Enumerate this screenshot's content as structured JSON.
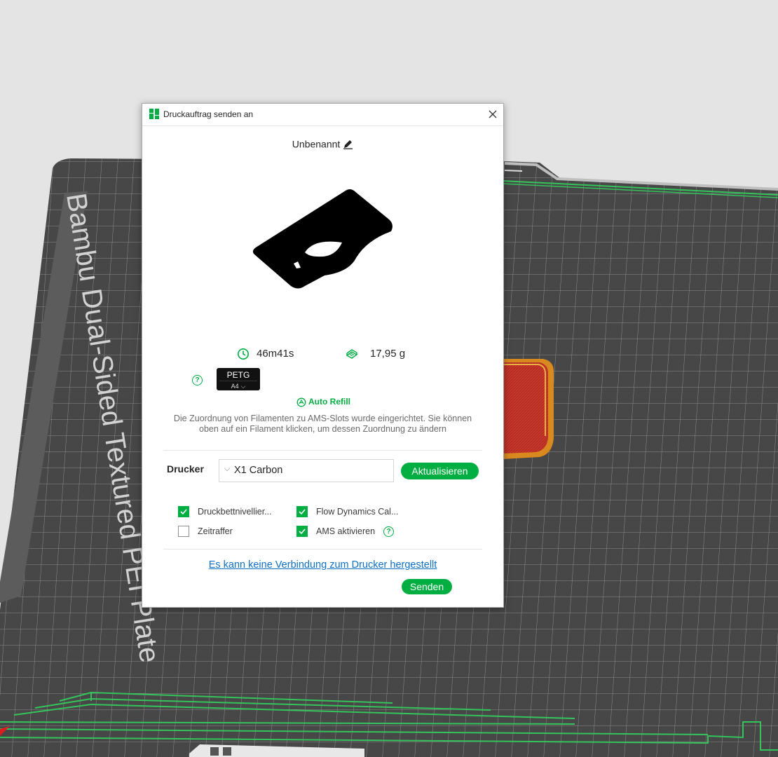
{
  "background": {
    "bed_label": "Bambu Dual-Sided Textured PEI Plate",
    "colors": {
      "bed": "#474747",
      "grid": "#8c8c8c",
      "accent": "#00ae42",
      "model": "#c8372a"
    }
  },
  "dialog": {
    "title": "Druckauftrag senden an",
    "close_icon": "close-icon",
    "plate_name": "Unbenannt",
    "edit_icon": "pencil-icon",
    "stats": {
      "time": "46m41s",
      "time_icon": "clock-icon",
      "weight": "17,95 g",
      "weight_icon": "filament-spool-icon"
    },
    "filament": {
      "help": "?",
      "material": "PETG",
      "slot": "A4",
      "color": "#111111"
    },
    "auto_refill": "Auto Refill",
    "info_text": "Die Zuordnung von Filamenten zu AMS-Slots wurde eingerichtet. Sie können oben auf ein Filament klicken, um dessen Zuordnung zu ändern",
    "printer": {
      "label": "Drucker",
      "selected": "X1 Carbon",
      "refresh_label": "Aktualisieren"
    },
    "options": [
      {
        "label": "Druckbettnivellier...",
        "checked": true
      },
      {
        "label": "Flow Dynamics Cal...",
        "checked": true
      },
      {
        "label": "Zeitraffer",
        "checked": false
      },
      {
        "label": "AMS aktivieren",
        "checked": true,
        "help": "?"
      }
    ],
    "connection_link": "Es kann keine Verbindung zum Drucker hergestellt",
    "send_label": "Senden",
    "accent_color": "#00ae42"
  }
}
